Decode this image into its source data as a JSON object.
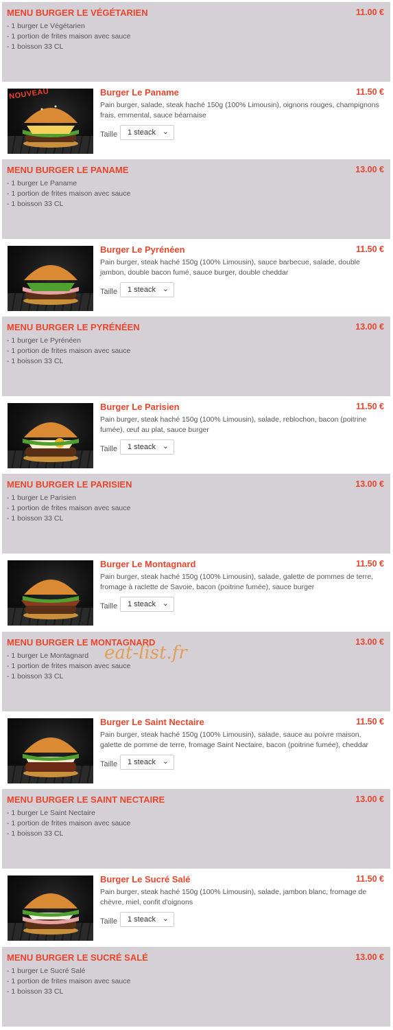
{
  "size_label": "Taille",
  "watermark": "eat-list.fr",
  "accent_color": "#e8452c",
  "menu_bg_color": "#d4d0d5",
  "items": [
    {
      "type": "menu",
      "title": "MENU BURGER LE VÉGÉTARIEN",
      "price": "11.00 €",
      "lines": [
        "- 1 burger Le Végétarien",
        "- 1 portion de frites maison avec sauce",
        "- 1 boisson 33 CL"
      ]
    },
    {
      "type": "burger",
      "title": "Burger Le Paname",
      "price": "11.50 €",
      "badge": "NOUVEAU",
      "description": "Pain burger, salade, steak haché 150g (100% Limousin), oignons rouges, champignons frais, emmental, sauce béarnaise",
      "size": "1 steack",
      "image": "burger-photo"
    },
    {
      "type": "menu",
      "title": "MENU BURGER LE PANAME",
      "price": "13.00 €",
      "lines": [
        "- 1 burger Le Paname",
        "- 1 portion de frites maison avec sauce",
        "- 1 boisson 33 CL"
      ]
    },
    {
      "type": "burger",
      "title": "Burger Le Pyrénéen",
      "price": "11.50 €",
      "description": "Pain burger, steak haché 150g (100% Limousin), sauce barbecue, salade, double jambon, double bacon fumé, sauce burger, double cheddar",
      "size": "1 steack",
      "image": "burger-photo"
    },
    {
      "type": "menu",
      "title": "MENU BURGER LE PYRÉNÉEN",
      "price": "13.00 €",
      "lines": [
        "- 1 burger Le Pyrénéen",
        "- 1 portion de frites maison avec sauce",
        "- 1 boisson 33 CL"
      ]
    },
    {
      "type": "burger",
      "title": "Burger Le Parisien",
      "price": "11.50 €",
      "description": "Pain burger, steak haché 150g (100% Limousin), salade, reblochon, bacon (poitrine fumée), œuf au plat, sauce burger",
      "size": "1 steack",
      "image": "burger-photo"
    },
    {
      "type": "menu",
      "title": "MENU BURGER LE PARISIEN",
      "price": "13.00 €",
      "lines": [
        "- 1 burger Le Parisien",
        "- 1 portion de frites maison avec sauce",
        "- 1 boisson 33 CL"
      ]
    },
    {
      "type": "burger",
      "title": "Burger Le Montagnard",
      "price": "11.50 €",
      "description": "Pain burger, steak haché 150g (100% Limousin), salade, galette de pommes de terre, fromage à raclette de Savoie, bacon (poitrine fumée), sauce burger",
      "size": "1 steack",
      "image": "burger-photo"
    },
    {
      "type": "menu",
      "title": "MENU BURGER LE MONTAGNARD",
      "price": "13.00 €",
      "lines": [
        "- 1 burger Le Montagnard",
        "- 1 portion de frites maison avec sauce",
        "- 1 boisson 33 CL"
      ]
    },
    {
      "type": "burger",
      "title": "Burger Le Saint Nectaire",
      "price": "11.50 €",
      "description": "Pain burger, steak haché 150g (100% Limousin), salade, sauce au poivre maison, galette de pomme de terre, fromage Saint Nectaire, bacon (poitrine fumée), cheddar",
      "size": "1 steack",
      "image": "burger-photo"
    },
    {
      "type": "menu",
      "title": "MENU BURGER LE SAINT NECTAIRE",
      "price": "13.00 €",
      "lines": [
        "- 1 burger Le Saint Nectaire",
        "- 1 portion de frites maison avec sauce",
        "- 1 boisson 33 CL"
      ]
    },
    {
      "type": "burger",
      "title": "Burger Le Sucré Salé",
      "price": "11.50 €",
      "description": "Pain burger, steak haché 150g (100% Limousin), salade, jambon blanc, fromage de chèvre, miel, confit d'oignons",
      "size": "1 steack",
      "image": "burger-photo"
    },
    {
      "type": "menu",
      "title": "MENU BURGER LE SUCRÉ SALÉ",
      "price": "13.00 €",
      "lines": [
        "- 1 burger Le Sucré Salé",
        "- 1 portion de frites maison avec sauce",
        "- 1 boisson 33 CL"
      ]
    }
  ]
}
